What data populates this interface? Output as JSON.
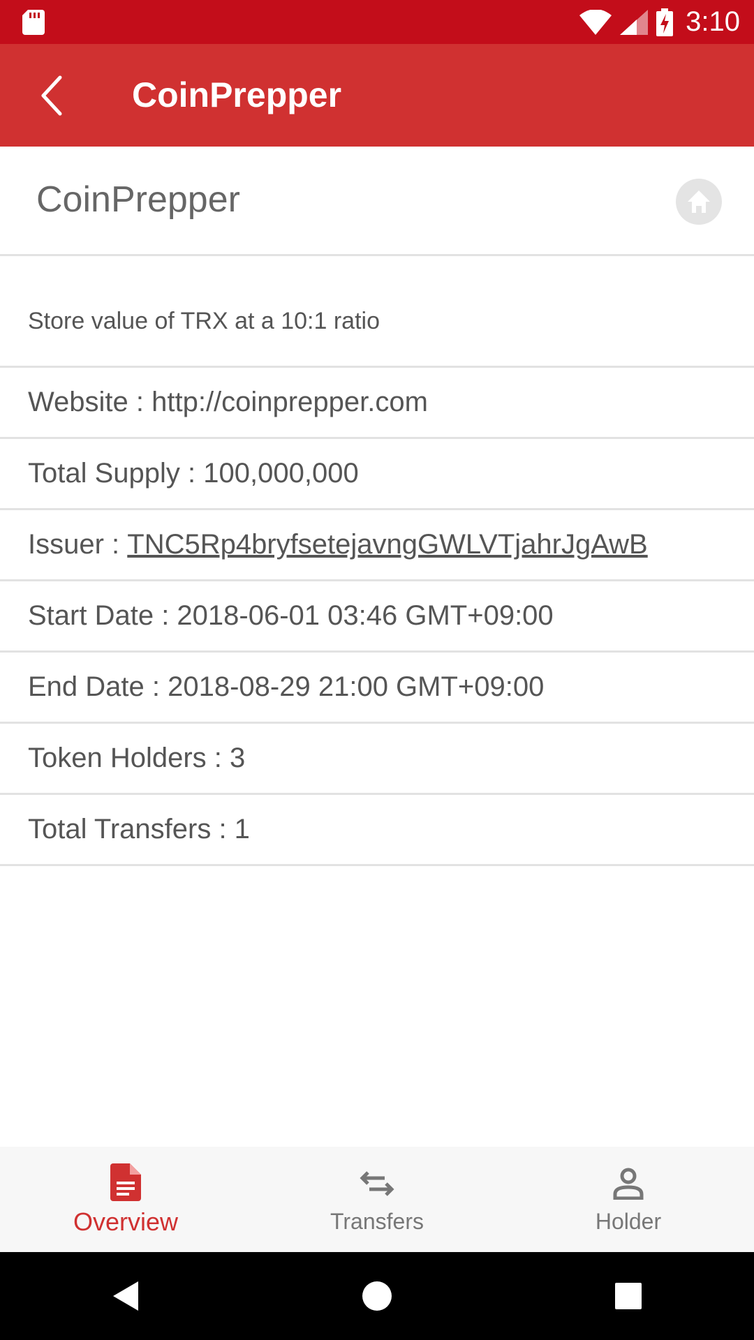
{
  "status_bar": {
    "time": "3:10",
    "icons": [
      "sd-card-icon",
      "wifi-icon",
      "signal-icon",
      "battery-charging-icon"
    ]
  },
  "app_bar": {
    "title": "CoinPrepper",
    "back_icon": "chevron-left-icon"
  },
  "token": {
    "name": "CoinPrepper",
    "home_icon": "home-icon",
    "description": "Store value of TRX at a 10:1 ratio"
  },
  "info": {
    "website": "Website : http://coinprepper.com",
    "total_supply": "Total Supply : 100,000,000",
    "issuer_label": "Issuer : ",
    "issuer_address": "TNC5Rp4bryfsetejavngGWLVTjahrJgAwB",
    "start_date": "Start Date : 2018-06-01 03:46 GMT+09:00",
    "end_date": "End Date : 2018-08-29 21:00 GMT+09:00",
    "token_holders": "Token Holders : 3",
    "total_transfers": "Total Transfers : 1"
  },
  "bottom_nav": {
    "items": [
      {
        "label": "Overview",
        "icon": "document-icon",
        "active": true
      },
      {
        "label": "Transfers",
        "icon": "swap-arrows-icon",
        "active": false
      },
      {
        "label": "Holder",
        "icon": "person-icon",
        "active": false
      }
    ]
  },
  "system_nav": {
    "icons": [
      "back-triangle-icon",
      "home-circle-icon",
      "recents-square-icon"
    ]
  },
  "colors": {
    "status_bar": "#c30d1a",
    "app_bar": "#d03131",
    "accent": "#d03131",
    "text": "#555555"
  }
}
